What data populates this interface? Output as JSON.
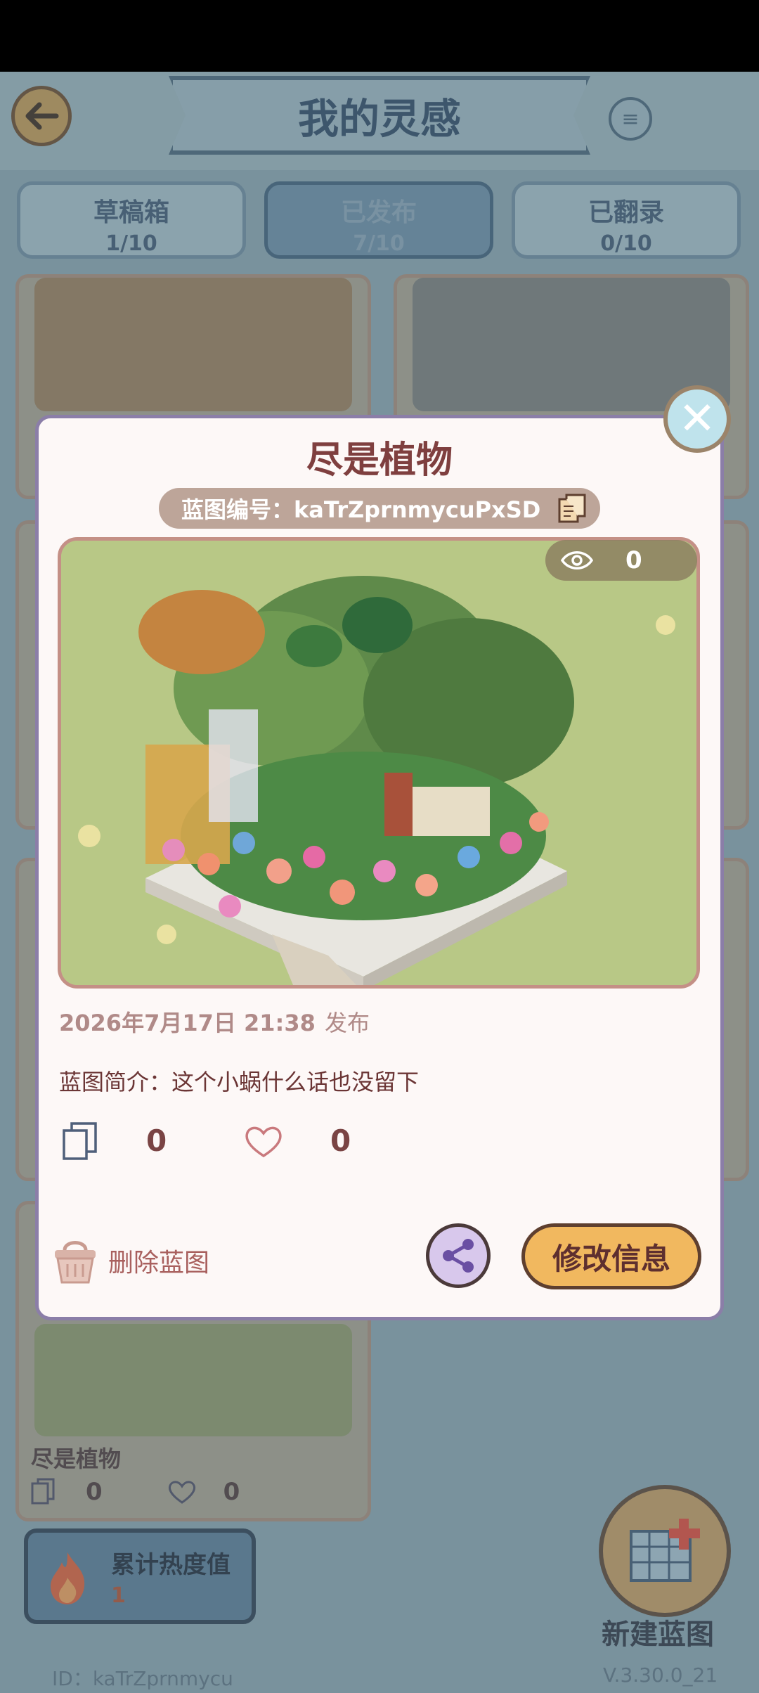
{
  "header": {
    "title": "我的灵感",
    "back_icon": "arrow-left-icon",
    "help_icon": "scroll-icon"
  },
  "tabs": [
    {
      "label": "草稿箱",
      "count": "1/10",
      "active": false
    },
    {
      "label": "已发布",
      "count": "7/10",
      "active": true
    },
    {
      "label": "已翻录",
      "count": "0/10",
      "active": false
    }
  ],
  "background_card": {
    "title": "尽是植物",
    "copies": "0",
    "likes": "0"
  },
  "heat": {
    "label": "累计热度值",
    "value": "1"
  },
  "new_blueprint_label": "新建蓝图",
  "footer": {
    "user_id": "ID：kaTrZprnmycu",
    "version": "V.3.30.0_21"
  },
  "modal": {
    "title": "尽是植物",
    "blueprint_id_text": "蓝图编号：kaTrZprnmycuPxSD",
    "views": "0",
    "publish_date": "2026年7月17日 21:38",
    "publish_label": "发布",
    "description": "蓝图简介：这个小蜗什么话也没留下",
    "copies": "0",
    "likes": "0",
    "delete_label": "删除蓝图",
    "edit_label": "修改信息"
  },
  "colors": {
    "modal_bg": "#fdf8f7",
    "title_color": "#7f3f3f",
    "edit_button": "#f1b85f",
    "share_button": "#d8c8ec"
  }
}
